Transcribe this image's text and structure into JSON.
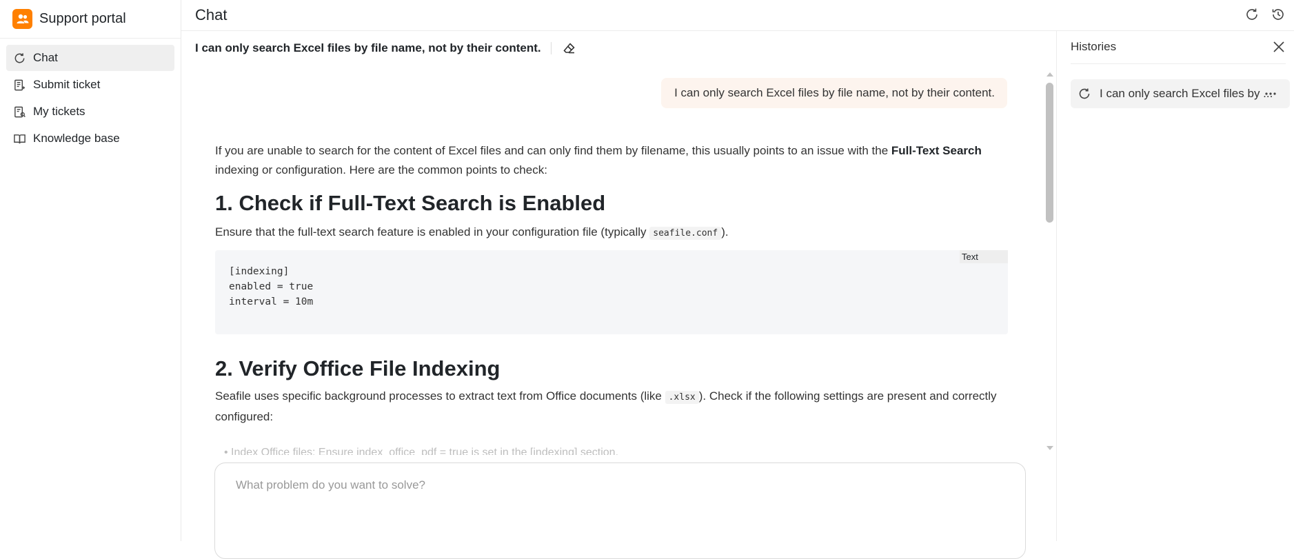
{
  "app": {
    "brand": "Support portal",
    "brand_color": "#ff8000"
  },
  "sidebar": {
    "items": [
      {
        "label": "Chat",
        "icon": "chat-refresh-icon",
        "active": true
      },
      {
        "label": "Submit ticket",
        "icon": "submit-ticket-icon"
      },
      {
        "label": "My tickets",
        "icon": "tickets-icon"
      },
      {
        "label": "Knowledge base",
        "icon": "book-icon"
      }
    ]
  },
  "header": {
    "title": "Chat",
    "buttons": [
      "new-chat-icon",
      "history-icon"
    ]
  },
  "chat": {
    "title": "I can only search Excel files by file name, not by their content.",
    "user_message": "I can only search Excel files by file name, not by their content.",
    "answer": {
      "intro_a": "If you are unable to search for the content of Excel files and can only find them by filename, this usually points to an issue with the ",
      "intro_bold": "Full-Text Search",
      "intro_b": " indexing or configuration. Here are the common points to check:",
      "h1": "1. Check if Full-Text Search is Enabled",
      "p1_a": "Ensure that the full-text search feature is enabled in your configuration file (typically ",
      "p1_code": "seafile.conf",
      "p1_b": ").",
      "code_lang": "Text",
      "code": "[indexing]\nenabled = true\ninterval = 10m",
      "h2": "2. Verify Office File Indexing",
      "p2_a": "Seafile uses specific background processes to extract text from Office documents (like ",
      "p2_code": ".xlsx",
      "p2_b": "). Check if the following settings are present and correctly configured:",
      "faded_bullet": "• Index Office files: Ensure index_office_pdf = true is set in the [indexing] section."
    }
  },
  "composer": {
    "placeholder": "What problem do you want to solve?"
  },
  "histories": {
    "title": "Histories",
    "items": [
      {
        "label": "I can only search Excel files by ..."
      }
    ]
  }
}
